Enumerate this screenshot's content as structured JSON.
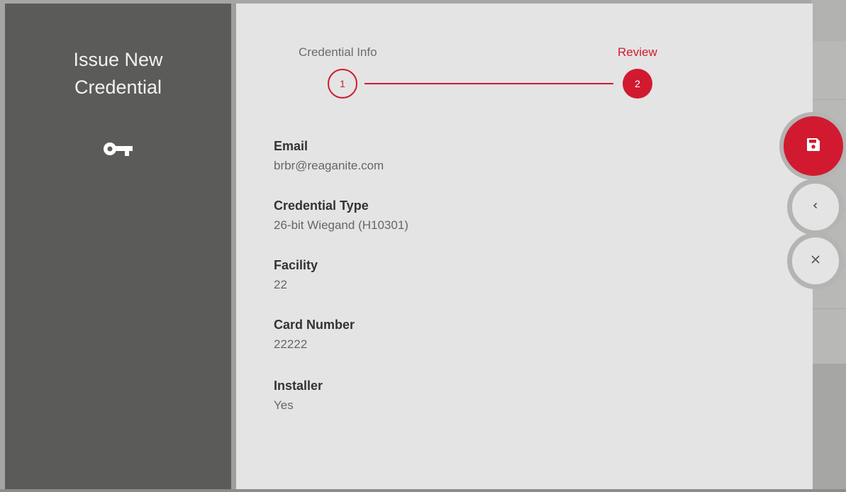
{
  "sidebar": {
    "title_line1": "Issue New",
    "title_line2": "Credential",
    "icon": "key-icon"
  },
  "stepper": {
    "steps": [
      {
        "label": "Credential Info",
        "number": "1",
        "state": "completed"
      },
      {
        "label": "Review",
        "number": "2",
        "state": "active"
      }
    ]
  },
  "review": {
    "fields": [
      {
        "label": "Email",
        "value": "brbr@reaganite.com"
      },
      {
        "label": "Credential Type",
        "value": "26-bit Wiegand (H10301)"
      },
      {
        "label": "Facility",
        "value": "22"
      },
      {
        "label": "Card Number",
        "value": "22222"
      },
      {
        "label": "Installer",
        "value": "Yes"
      }
    ]
  },
  "actions": {
    "save_icon": "floppy-disk-icon",
    "back_icon": "chevron-left-icon",
    "close_icon": "close-icon"
  },
  "colors": {
    "accent": "#d11a30",
    "sidebar": "#5b5b5a",
    "panel": "#e4e4e4"
  }
}
